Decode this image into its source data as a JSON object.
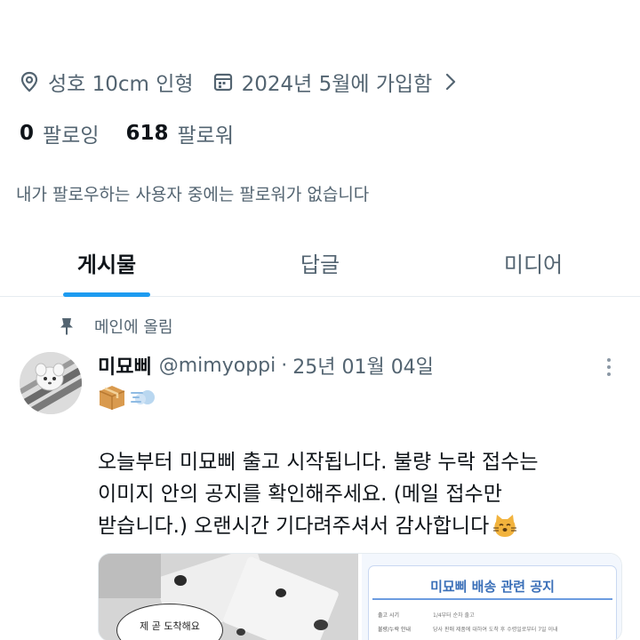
{
  "profile": {
    "location": "성호 10cm 인형",
    "joined": "2024년 5월에 가입함",
    "following_count": "0",
    "following_label": "팔로잉",
    "followers_count": "618",
    "followers_label": "팔로워",
    "no_mutual_text": "내가 팔로우하는 사용자 중에는 팔로워가 없습니다",
    "icons": [
      "location-pin-icon",
      "calendar-icon",
      "chevron-right-icon"
    ]
  },
  "tabs": [
    {
      "label": "게시물",
      "active": true
    },
    {
      "label": "답글",
      "active": false
    },
    {
      "label": "미디어",
      "active": false
    }
  ],
  "post": {
    "pinned_label": "메인에 올림",
    "author_name": "미묘삐",
    "author_handle": "@mimyoppi",
    "separator": "·",
    "date": "25년 01월 04일",
    "name_emojis": [
      "package-emoji",
      "dash-emoji"
    ],
    "text_lines": [
      "오늘부터 미묘삐 출고 시작됩니다. 불량 누락 접수는",
      "이미지 안의 공지를 확인해주세요. (메일 접수만",
      "받습니다.) 오랜시간 기다려주셔서 감사합니다"
    ],
    "trailing_emoji": "cat-emoji",
    "media": {
      "left_caption": "제 곧 도착해요",
      "right_title": "미묘삐 배송 관련 공지",
      "right_rows": [
        {
          "key": "출고 시기",
          "value": "1/4부터 순차 출고"
        },
        {
          "key": "불량/누락 안내",
          "value": "당사 판매 제품에 대하여 도착 후 수령일로부터 7일 이내"
        },
        {
          "key": "",
          "value": ""
        }
      ]
    }
  },
  "colors": {
    "accent": "#1d9bf0",
    "text_primary": "#0f1419",
    "text_secondary": "#536471",
    "divider": "#e6ecf0"
  }
}
